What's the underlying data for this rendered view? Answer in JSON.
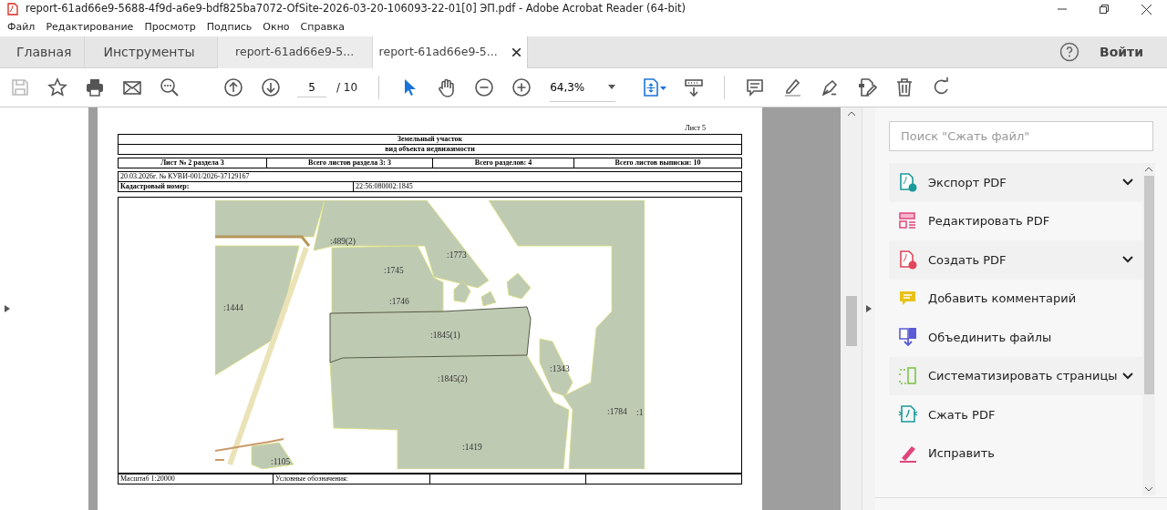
{
  "window": {
    "title": "report-61ad66e9-5688-4f9d-a6e9-bdf825ba7072-OfSite-2026-03-20-106093-22-01[0] ЭП.pdf - Adobe Acrobat Reader (64-bit)"
  },
  "menu": [
    "Файл",
    "Редактирование",
    "Просмотр",
    "Подпись",
    "Окно",
    "Справка"
  ],
  "tabs": [
    {
      "label": "Главная",
      "kind": "nav",
      "selected": false
    },
    {
      "label": "Инструменты",
      "kind": "nav",
      "selected": false
    },
    {
      "label": "report-61ad66e9-5...",
      "kind": "document",
      "selected": false
    },
    {
      "label": "report-61ad66e9-5...",
      "kind": "document",
      "selected": true
    }
  ],
  "sign_in": "Войти",
  "toolbar": {
    "page": "5",
    "page_total": "/ 10",
    "zoom": "64,3%"
  },
  "document": {
    "sheet": "Лист 5",
    "title": "Земельный участок",
    "subtitle": "вид объекта недвижимости",
    "info_cells": [
      "Лист № 2 раздела 3",
      "Всего листов раздела 3: 3",
      "Всего разделов: 4",
      "Всего листов выписки: 10"
    ],
    "statement": "20.03.2026г. № КУВИ-001/2026-37129167",
    "cadastral_label": "Кадастровый номер:",
    "cadastral_number": "22:56:080002:1845",
    "map_labels": [
      ":489(2)",
      ":1773",
      ":1745",
      ":1746",
      ":1444",
      ":1845(1)",
      ":1845(2)",
      ":1343",
      ":1784",
      ":1",
      ":1419",
      ":1105"
    ],
    "scale": "Масштаб 1:20000",
    "legend": "Условные обозначения:"
  },
  "sidebar": {
    "search": {
      "placeholder": "Поиск \"Сжать файл\""
    },
    "tools": [
      {
        "label": "Экспорт PDF",
        "expandable": true
      },
      {
        "label": "Редактировать PDF",
        "expandable": false
      },
      {
        "label": "Создать PDF",
        "expandable": true
      },
      {
        "label": "Добавить комментарий",
        "expandable": false
      },
      {
        "label": "Объединить файлы",
        "expandable": false
      },
      {
        "label": "Систематизировать страницы",
        "expandable": true
      },
      {
        "label": "Сжать PDF",
        "expandable": false
      },
      {
        "label": "Исправить",
        "expandable": false
      }
    ]
  }
}
